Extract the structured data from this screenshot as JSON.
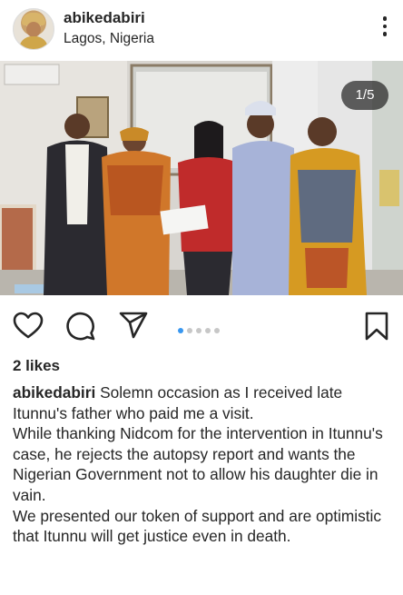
{
  "post": {
    "username": "abikedabiri",
    "location": "Lagos, Nigeria",
    "counter": "1/5",
    "likes": "2 likes",
    "caption_user": "abikedabiri",
    "caption_lines": [
      "Solemn occasion as I received late Itunnu's father who paid me a visit.",
      "While thanking Nidcom for the intervention in Itunnu's case, he rejects the autopsy report and wants the Nigerian Government not to allow his daughter  die in vain.",
      "We presented our token of support and are optimistic that Itunnu will get justice even in death."
    ]
  },
  "carousel": {
    "count": 5,
    "active": 1
  },
  "icons": [
    "more-options-icon",
    "like-heart-icon",
    "comment-icon",
    "share-icon",
    "save-bookmark-icon"
  ],
  "colors": {
    "text": "#262626",
    "active_dot": "#3897f0",
    "inactive_dot": "#c7c7c7"
  }
}
